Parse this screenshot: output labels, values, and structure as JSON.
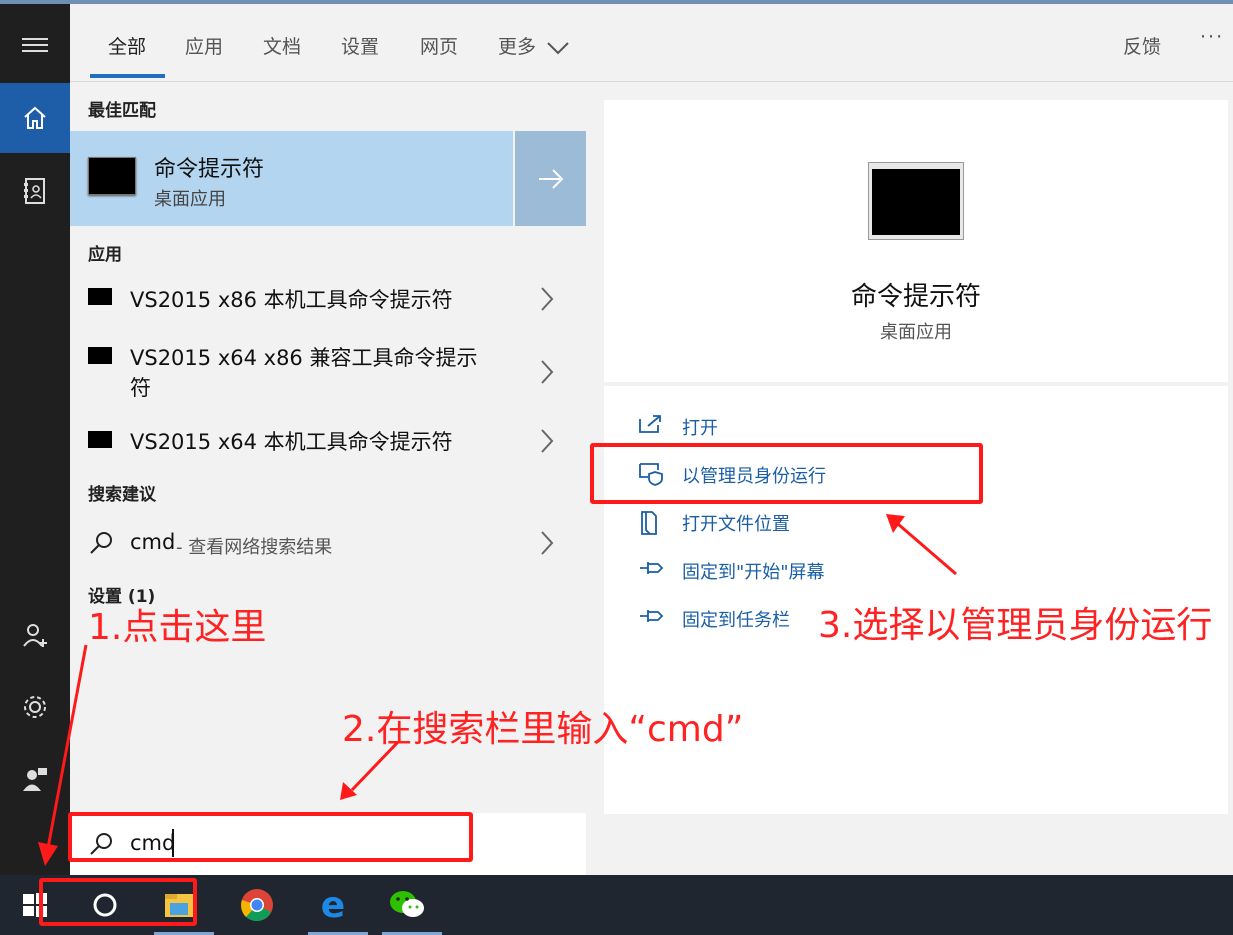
{
  "header": {
    "tabs": [
      {
        "label": "全部"
      },
      {
        "label": "应用"
      },
      {
        "label": "文档"
      },
      {
        "label": "设置"
      },
      {
        "label": "网页"
      },
      {
        "label": "更多"
      }
    ],
    "feedback": "反馈",
    "overflow": "···"
  },
  "results": {
    "best_match_heading": "最佳匹配",
    "best_match": {
      "title": "命令提示符",
      "subtitle": "桌面应用"
    },
    "apps_heading": "应用",
    "apps": [
      {
        "line1": "VS2015 x86 本机工具命令提示符",
        "line2": ""
      },
      {
        "line1": "VS2015 x64 x86 兼容工具命令提示",
        "line2": "符"
      },
      {
        "line1": "VS2015 x64 本机工具命令提示符",
        "line2": ""
      }
    ],
    "suggest_heading": "搜索建议",
    "suggestion": {
      "query": "cmd",
      "hint": " - 查看网络搜索结果"
    },
    "settings_heading": "设置 (1)"
  },
  "detail": {
    "title": "命令提示符",
    "subtitle": "桌面应用",
    "actions": [
      {
        "label": "打开",
        "icon": "open-icon"
      },
      {
        "label": "以管理员身份运行",
        "icon": "shield-icon"
      },
      {
        "label": "打开文件位置",
        "icon": "file-location-icon"
      },
      {
        "label": "固定到\"开始\"屏幕",
        "icon": "pin-icon"
      },
      {
        "label": "固定到任务栏",
        "icon": "pin-icon"
      }
    ]
  },
  "search": {
    "value": "cmd"
  },
  "annotations": {
    "step1": "1.点击这里",
    "step2": "2.在搜索栏里输入“cmd”",
    "step3": "3.选择以管理员身份运行"
  },
  "colors": {
    "accent": "#1e6fbf",
    "annotation": "#ff1a1a",
    "best_match_bg": "#b4d5f0"
  }
}
